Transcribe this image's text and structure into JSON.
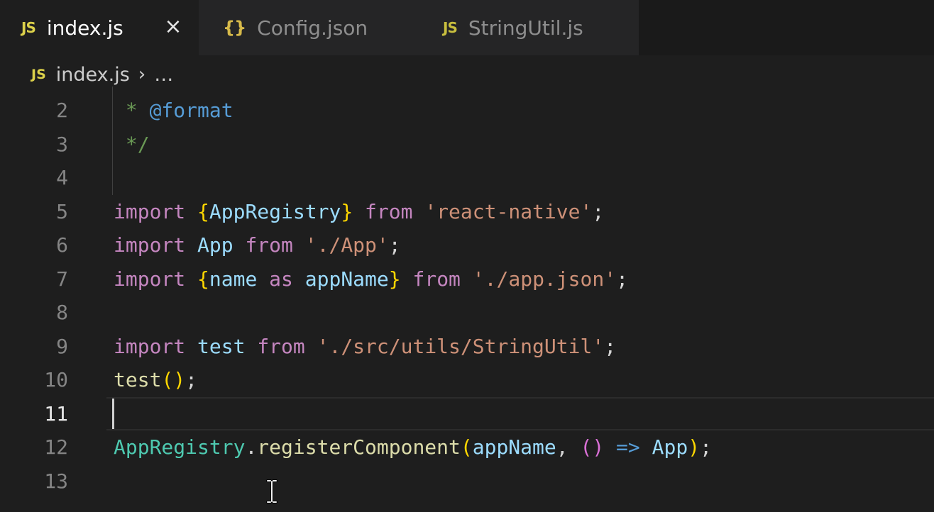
{
  "tabs": [
    {
      "icon": "JS",
      "label": "index.js",
      "active": true
    },
    {
      "icon": "{}",
      "label": "Config.json",
      "active": false
    },
    {
      "icon": "JS",
      "label": "StringUtil.js",
      "active": false
    }
  ],
  "close_icon": "×",
  "breadcrumb": {
    "icon": "JS",
    "file": "index.js",
    "separator": "›",
    "more": "…"
  },
  "editor": {
    "active_line": 11,
    "lines": [
      {
        "number": "2",
        "tokens": [
          {
            "t": " * ",
            "c": "cmt"
          },
          {
            "t": "@format",
            "c": "tag"
          }
        ]
      },
      {
        "number": "3",
        "tokens": [
          {
            "t": " */",
            "c": "cmt"
          }
        ]
      },
      {
        "number": "4",
        "tokens": []
      },
      {
        "number": "5",
        "tokens": [
          {
            "t": "import",
            "c": "kw"
          },
          {
            "t": " ",
            "c": "punc"
          },
          {
            "t": "{",
            "c": "br1"
          },
          {
            "t": "AppRegistry",
            "c": "var"
          },
          {
            "t": "}",
            "c": "br1"
          },
          {
            "t": " ",
            "c": "punc"
          },
          {
            "t": "from",
            "c": "kw"
          },
          {
            "t": " ",
            "c": "punc"
          },
          {
            "t": "'react-native'",
            "c": "str"
          },
          {
            "t": ";",
            "c": "punc"
          }
        ]
      },
      {
        "number": "6",
        "tokens": [
          {
            "t": "import",
            "c": "kw"
          },
          {
            "t": " ",
            "c": "punc"
          },
          {
            "t": "App",
            "c": "var"
          },
          {
            "t": " ",
            "c": "punc"
          },
          {
            "t": "from",
            "c": "kw"
          },
          {
            "t": " ",
            "c": "punc"
          },
          {
            "t": "'./App'",
            "c": "str"
          },
          {
            "t": ";",
            "c": "punc"
          }
        ]
      },
      {
        "number": "7",
        "tokens": [
          {
            "t": "import",
            "c": "kw"
          },
          {
            "t": " ",
            "c": "punc"
          },
          {
            "t": "{",
            "c": "br1"
          },
          {
            "t": "name",
            "c": "var"
          },
          {
            "t": " ",
            "c": "punc"
          },
          {
            "t": "as",
            "c": "kw"
          },
          {
            "t": " ",
            "c": "punc"
          },
          {
            "t": "appName",
            "c": "var"
          },
          {
            "t": "}",
            "c": "br1"
          },
          {
            "t": " ",
            "c": "punc"
          },
          {
            "t": "from",
            "c": "kw"
          },
          {
            "t": " ",
            "c": "punc"
          },
          {
            "t": "'./app.json'",
            "c": "str"
          },
          {
            "t": ";",
            "c": "punc"
          }
        ]
      },
      {
        "number": "8",
        "tokens": []
      },
      {
        "number": "9",
        "tokens": [
          {
            "t": "import",
            "c": "kw"
          },
          {
            "t": " ",
            "c": "punc"
          },
          {
            "t": "test",
            "c": "var"
          },
          {
            "t": " ",
            "c": "punc"
          },
          {
            "t": "from",
            "c": "kw"
          },
          {
            "t": " ",
            "c": "punc"
          },
          {
            "t": "'./src/utils/StringUtil'",
            "c": "str"
          },
          {
            "t": ";",
            "c": "punc"
          }
        ]
      },
      {
        "number": "10",
        "tokens": [
          {
            "t": "test",
            "c": "fn"
          },
          {
            "t": "()",
            "c": "br1"
          },
          {
            "t": ";",
            "c": "punc"
          }
        ]
      },
      {
        "number": "11",
        "tokens": []
      },
      {
        "number": "12",
        "tokens": [
          {
            "t": "AppRegistry",
            "c": "cls"
          },
          {
            "t": ".",
            "c": "punc"
          },
          {
            "t": "registerComponent",
            "c": "fn"
          },
          {
            "t": "(",
            "c": "br1"
          },
          {
            "t": "appName",
            "c": "var"
          },
          {
            "t": ", ",
            "c": "punc"
          },
          {
            "t": "()",
            "c": "br2"
          },
          {
            "t": " ",
            "c": "punc"
          },
          {
            "t": "=>",
            "c": "kw2"
          },
          {
            "t": " ",
            "c": "punc"
          },
          {
            "t": "App",
            "c": "var"
          },
          {
            "t": ")",
            "c": "br1"
          },
          {
            "t": ";",
            "c": "punc"
          }
        ]
      },
      {
        "number": "13",
        "tokens": []
      }
    ]
  },
  "colors": {
    "background": "#1e1e1e",
    "keyword": "#c586c0",
    "string": "#ce9178",
    "comment": "#6a9955",
    "variable": "#9cdcfe",
    "function": "#dcdcaa",
    "class": "#4ec9b0",
    "bracket": "#ffd700"
  }
}
